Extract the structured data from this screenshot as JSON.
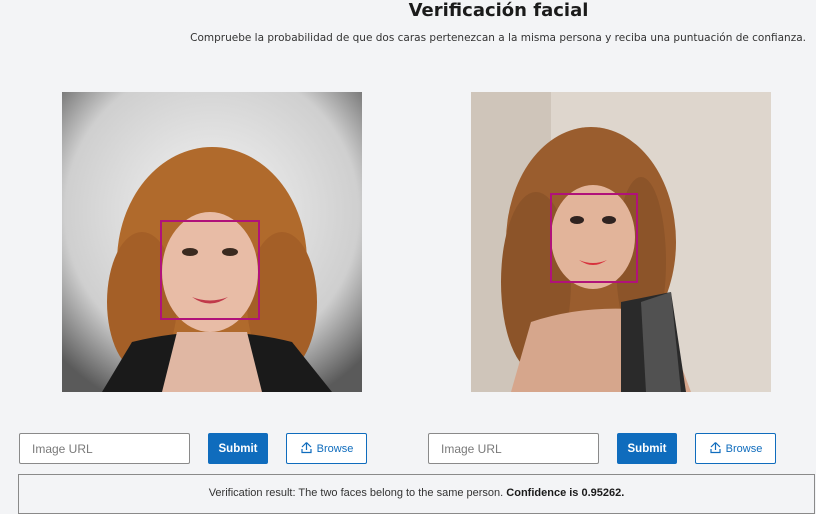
{
  "header": {
    "title": "Verificación facial",
    "subtitle": "Compruebe la probabilidad de que dos caras pertenezcan a la misma persona y reciba una puntuación de confianza."
  },
  "panels": [
    {
      "url_placeholder": "Image URL",
      "submit_label": "Submit",
      "browse_label": "Browse"
    },
    {
      "url_placeholder": "Image URL",
      "submit_label": "Submit",
      "browse_label": "Browse"
    }
  ],
  "result": {
    "text": "Verification result: The two faces belong to the same person.",
    "confidence": "Confidence is 0.95262."
  },
  "colors": {
    "accent": "#0f6cbd",
    "face_box": "#b0127a"
  }
}
